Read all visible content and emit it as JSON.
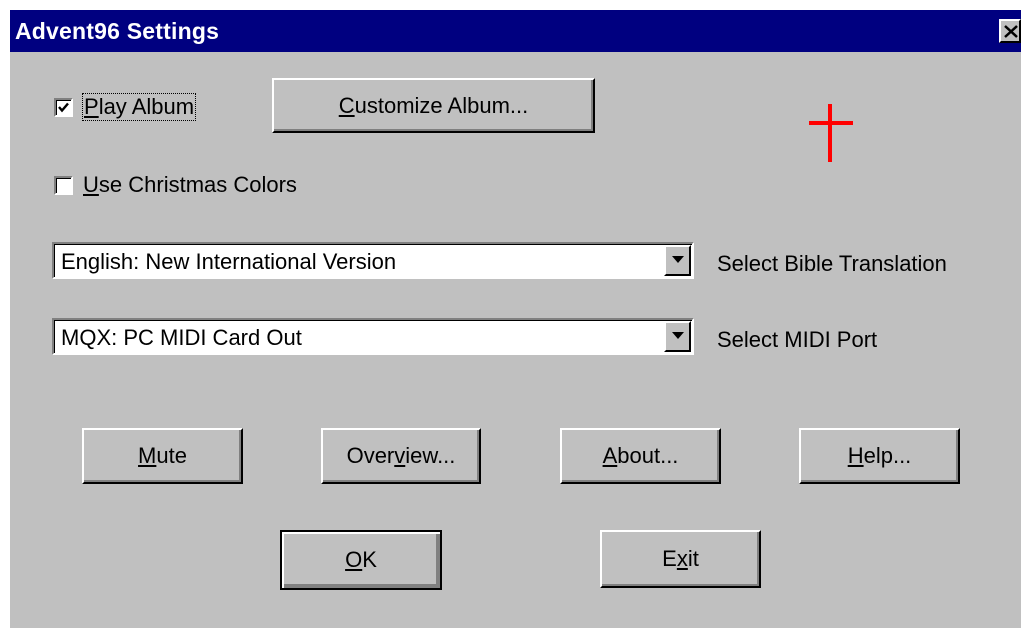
{
  "window": {
    "title": "Advent96 Settings",
    "close_glyph": "✕"
  },
  "options": {
    "play_album": {
      "label_mnemonic": "P",
      "label_rest": "lay Album",
      "checked": true
    },
    "christmas_colors": {
      "label_mnemonic": "U",
      "label_rest": "se Christmas Colors",
      "checked": false
    }
  },
  "buttons": {
    "customize_album": {
      "mnemonic": "C",
      "rest": "ustomize Album..."
    },
    "mute": {
      "mnemonic": "M",
      "rest": "ute"
    },
    "overview": {
      "pre": "Over",
      "mnemonic": "v",
      "rest": "iew..."
    },
    "about": {
      "mnemonic": "A",
      "rest": "bout..."
    },
    "help": {
      "mnemonic": "H",
      "rest": "elp..."
    },
    "ok": {
      "mnemonic": "O",
      "rest": "K"
    },
    "exit": {
      "pre": "E",
      "mnemonic": "x",
      "rest": "it"
    }
  },
  "bible_translation": {
    "value": "English: New International Version",
    "label": "Select Bible Translation"
  },
  "midi_port": {
    "value": "MQX: PC MIDI Card Out",
    "label": "Select MIDI Port"
  },
  "icons": {
    "cross": "cross-icon",
    "dropdown": "chevron-down-icon",
    "checkmark": "checkmark-icon"
  },
  "colors": {
    "titlebar": "#000080",
    "face": "#c0c0c0",
    "cross": "#ff0000"
  }
}
